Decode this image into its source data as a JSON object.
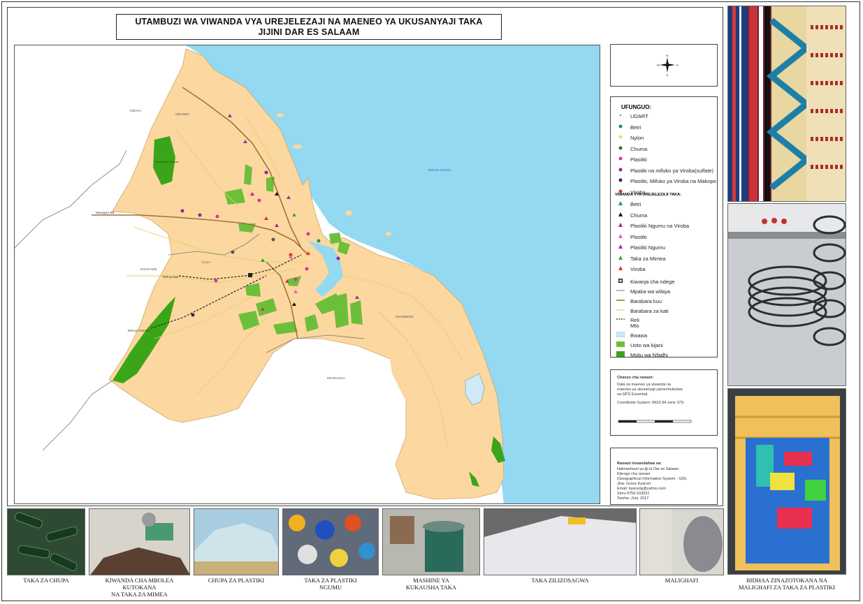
{
  "map": {
    "title_line1": "UTAMBUZI WA VIWANDA VYA UREJELEZAJI  NA MAENEO YA UKUSANYAJI TAKA",
    "title_line2": "JIJINI DAR ES SALAAM",
    "compass": {
      "n": "N",
      "s": "S",
      "e": "E",
      "w": "W"
    },
    "labels": {
      "kibaha": "KIBAHA",
      "ubungo": "UBUNGO",
      "ilala": "ILALA",
      "kisarawe": "KISARAWE",
      "kigamboni": "KIGAMBONI",
      "mkuranga": "MKURANGA",
      "ocean": "INDIAN OCEAN",
      "morogoro": "Morogoro Rd",
      "reli_kati": "Reli ya kati",
      "reli_tazara": "Reli ya TAZARA",
      "forest": "Pande Game Reserve"
    },
    "colors": {
      "land": "#fcd7a0",
      "sea": "#93d9f2",
      "green": "#6cbf3a",
      "forest": "#3aa518",
      "road_main": "#9c7536",
      "road_minor": "#e0d26a",
      "boundary": "#777777"
    }
  },
  "legend": {
    "title": "UFUNGUO:",
    "collection": [
      {
        "label": "UDART",
        "color": "#888888",
        "icon": "dot-small"
      },
      {
        "label": "Betri",
        "color": "#2a8a5a",
        "icon": "dot"
      },
      {
        "label": "Nylon",
        "color": "#e8e050",
        "icon": "dot"
      },
      {
        "label": "Chuma",
        "color": "#555555",
        "icon": "dot"
      },
      {
        "label": "Plastiki",
        "color": "#e030a0",
        "icon": "dot"
      },
      {
        "label": "Plastiki na mifuko ya Viroba(sulfate)",
        "color": "#a02090",
        "icon": "dot"
      },
      {
        "label": "Plastiki, Mifuko ya Viroba na Makopo",
        "color": "#402060",
        "icon": "dot"
      },
      {
        "label": "Viroba",
        "color": "#e03030",
        "icon": "dot"
      }
    ],
    "factories_title": "VIWANDA VYA UREJELEZAJI TAKA:",
    "factories": [
      {
        "label": "Betri",
        "color": "#2a9a4a"
      },
      {
        "label": "Chuma",
        "color": "#111111"
      },
      {
        "label": "Plastiki Ngumu na Viroba",
        "color": "#b02090"
      },
      {
        "label": "Plastiki",
        "color": "#f060b0"
      },
      {
        "label": "Plastiki Ngumu",
        "color": "#a030a0"
      },
      {
        "label": "Taka za Mimea",
        "color": "#30b030"
      },
      {
        "label": "Viroba",
        "color": "#e03030"
      }
    ],
    "other": [
      {
        "label": "Kiwanja cha ndege",
        "icon": "airport-icon"
      },
      {
        "label": "Mpaka wa wilaya",
        "icon": "boundary-line"
      },
      {
        "label": "Barabara kuu",
        "icon": "main-road-line"
      },
      {
        "label": "Barabara za kati",
        "icon": "minor-road-line"
      },
      {
        "label": "Reli",
        "icon": "rail-line"
      },
      {
        "label": "Mto",
        "icon": "river-line"
      },
      {
        "label": "Bwawa",
        "icon": "dam-fill"
      },
      {
        "label": "Uoto wa kijani",
        "icon": "green-fill"
      },
      {
        "label": "Msitu wa hifadhi",
        "icon": "forest-fill"
      }
    ]
  },
  "source": {
    "heading": "Chanzo cha ramani:",
    "line1": "Data za maeneo ya viwanda na",
    "line2": "maeneo ya ukusanyaji yamechukuliwa",
    "line3": "na GPS Essential.",
    "crs": "Coordinate System: WGS 84 zone 37S"
  },
  "credits": {
    "heading": "Ramani imeandaliwa na:",
    "lines": [
      "Halmashauri ya jiji la Dar es Salaam",
      "Kitengo cha ramani",
      "(Geographical Information System - GIS)",
      "Jina: Grace Kyaruzi",
      "Email: kyaruzig@yahoo.com",
      "Simu 0759-103021",
      "Tarehe: Juni, 2017"
    ]
  },
  "captions": {
    "c1": "TAKA ZA CHUPA",
    "c2a": "KIWANDA CHA MBOLEA",
    "c2b": "KUTOKANA",
    "c2c": "NA TAKA ZA MIMEA",
    "c3": "CHUPA ZA PLASTIKI",
    "c4a": "TAKA ZA PLASTIKI",
    "c4b": "NGUMU",
    "c5a": "MASHINE YA",
    "c5b": "KUKAUSHA TAKA",
    "c6": "TAKA ZILIZOSAGWA",
    "c7": "MALIGHAFI",
    "c8a": "BIDHAA ZINAZOTOKANA NA",
    "c8b": "MALIGHAFI ZA TAKA ZA PLASTIKI"
  }
}
